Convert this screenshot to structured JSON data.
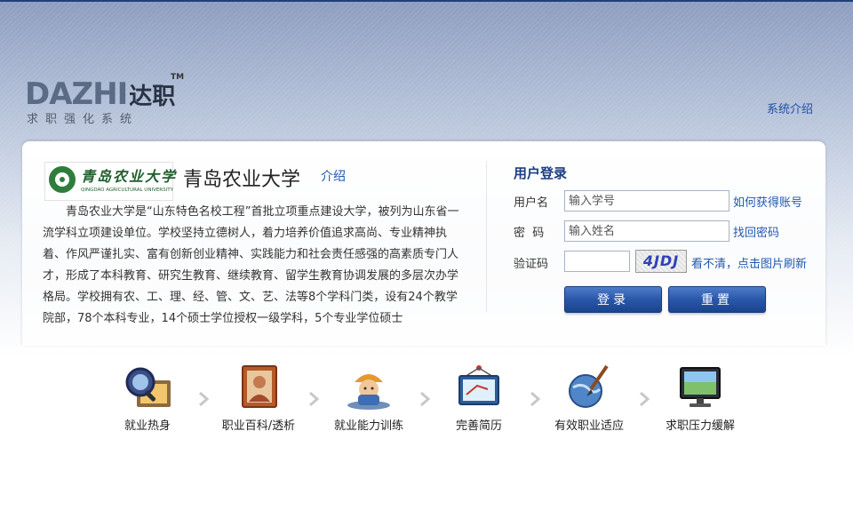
{
  "logo": {
    "brand_latin": "DAZHI",
    "brand_cn": "达职",
    "tm": "TM",
    "tagline": "求职强化系统"
  },
  "header": {
    "system_intro_link": "系统介绍"
  },
  "university": {
    "name": "青岛农业大学",
    "intro_link": "介绍",
    "logo_text_cn": "青岛农业大学",
    "logo_text_en": "QINGDAO AGRICULTURAL UNIVERSITY",
    "description": "青岛农业大学是“山东特色名校工程”首批立项重点建设大学，被列为山东省一流学科立项建设单位。学校坚持立德树人，着力培养价值追求高尚、专业精神执着、作风严谨扎实、富有创新创业精神、实践能力和社会责任感强的高素质专门人才，形成了本科教育、研究生教育、继续教育、留学生教育协调发展的多层次办学格局。学校拥有农、工、理、经、管、文、艺、法等8个学科门类，设有24个教学院部，78个本科专业，14个硕士学位授权一级学科，5个专业学位硕士"
  },
  "login": {
    "title": "用户登录",
    "username_label": "用户名",
    "username_placeholder": "输入学号",
    "get_account_link": "如何获得账号",
    "password_label": "密  码",
    "password_placeholder": "输入姓名",
    "find_password_link": "找回密码",
    "captcha_label": "验证码",
    "captcha_value": "",
    "captcha_image_text": "4JDJ",
    "refresh_captcha_link": "看不清，点击图片刷新",
    "login_button": "登录",
    "reset_button": "重置"
  },
  "features": [
    {
      "label": "就业热身",
      "icon": "magnifier-icon"
    },
    {
      "label": "职业百科/透析",
      "icon": "portrait-icon"
    },
    {
      "label": "就业能力训练",
      "icon": "worker-icon"
    },
    {
      "label": "完善简历",
      "icon": "whiteboard-icon"
    },
    {
      "label": "有效职业适应",
      "icon": "globe-brush-icon"
    },
    {
      "label": "求职压力缓解",
      "icon": "monitor-icon"
    }
  ],
  "colors": {
    "accent_blue": "#2058b0",
    "button_blue": "#2a57a9",
    "title_navy": "#1b3d80",
    "uni_green": "#1e5f2c"
  }
}
